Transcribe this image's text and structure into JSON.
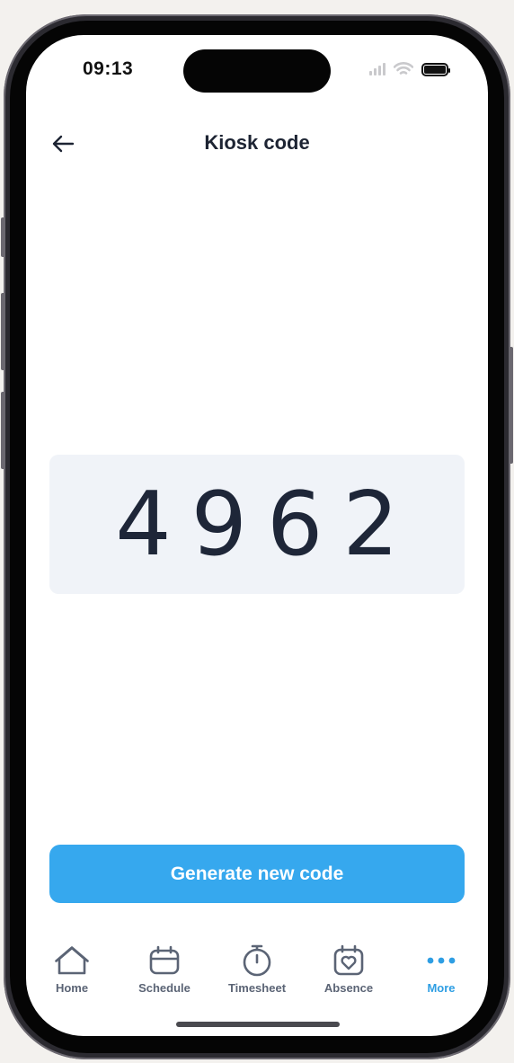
{
  "status_bar": {
    "time": "09:13"
  },
  "header": {
    "title": "Kiosk code"
  },
  "kiosk": {
    "code": "4962"
  },
  "actions": {
    "generate_label": "Generate new code"
  },
  "tab_bar": {
    "items": [
      {
        "label": "Home",
        "icon": "home-icon"
      },
      {
        "label": "Schedule",
        "icon": "calendar-icon"
      },
      {
        "label": "Timesheet",
        "icon": "stopwatch-icon"
      },
      {
        "label": "Absence",
        "icon": "calendar-heart-icon"
      },
      {
        "label": "More",
        "icon": "more-dots-icon"
      }
    ],
    "active": "More"
  },
  "colors": {
    "accent": "#36a8ee",
    "text_dark": "#1d2433",
    "code_bg": "#f0f3f8",
    "tab_inactive": "#5b6475",
    "tab_active": "#2e9ee3"
  }
}
